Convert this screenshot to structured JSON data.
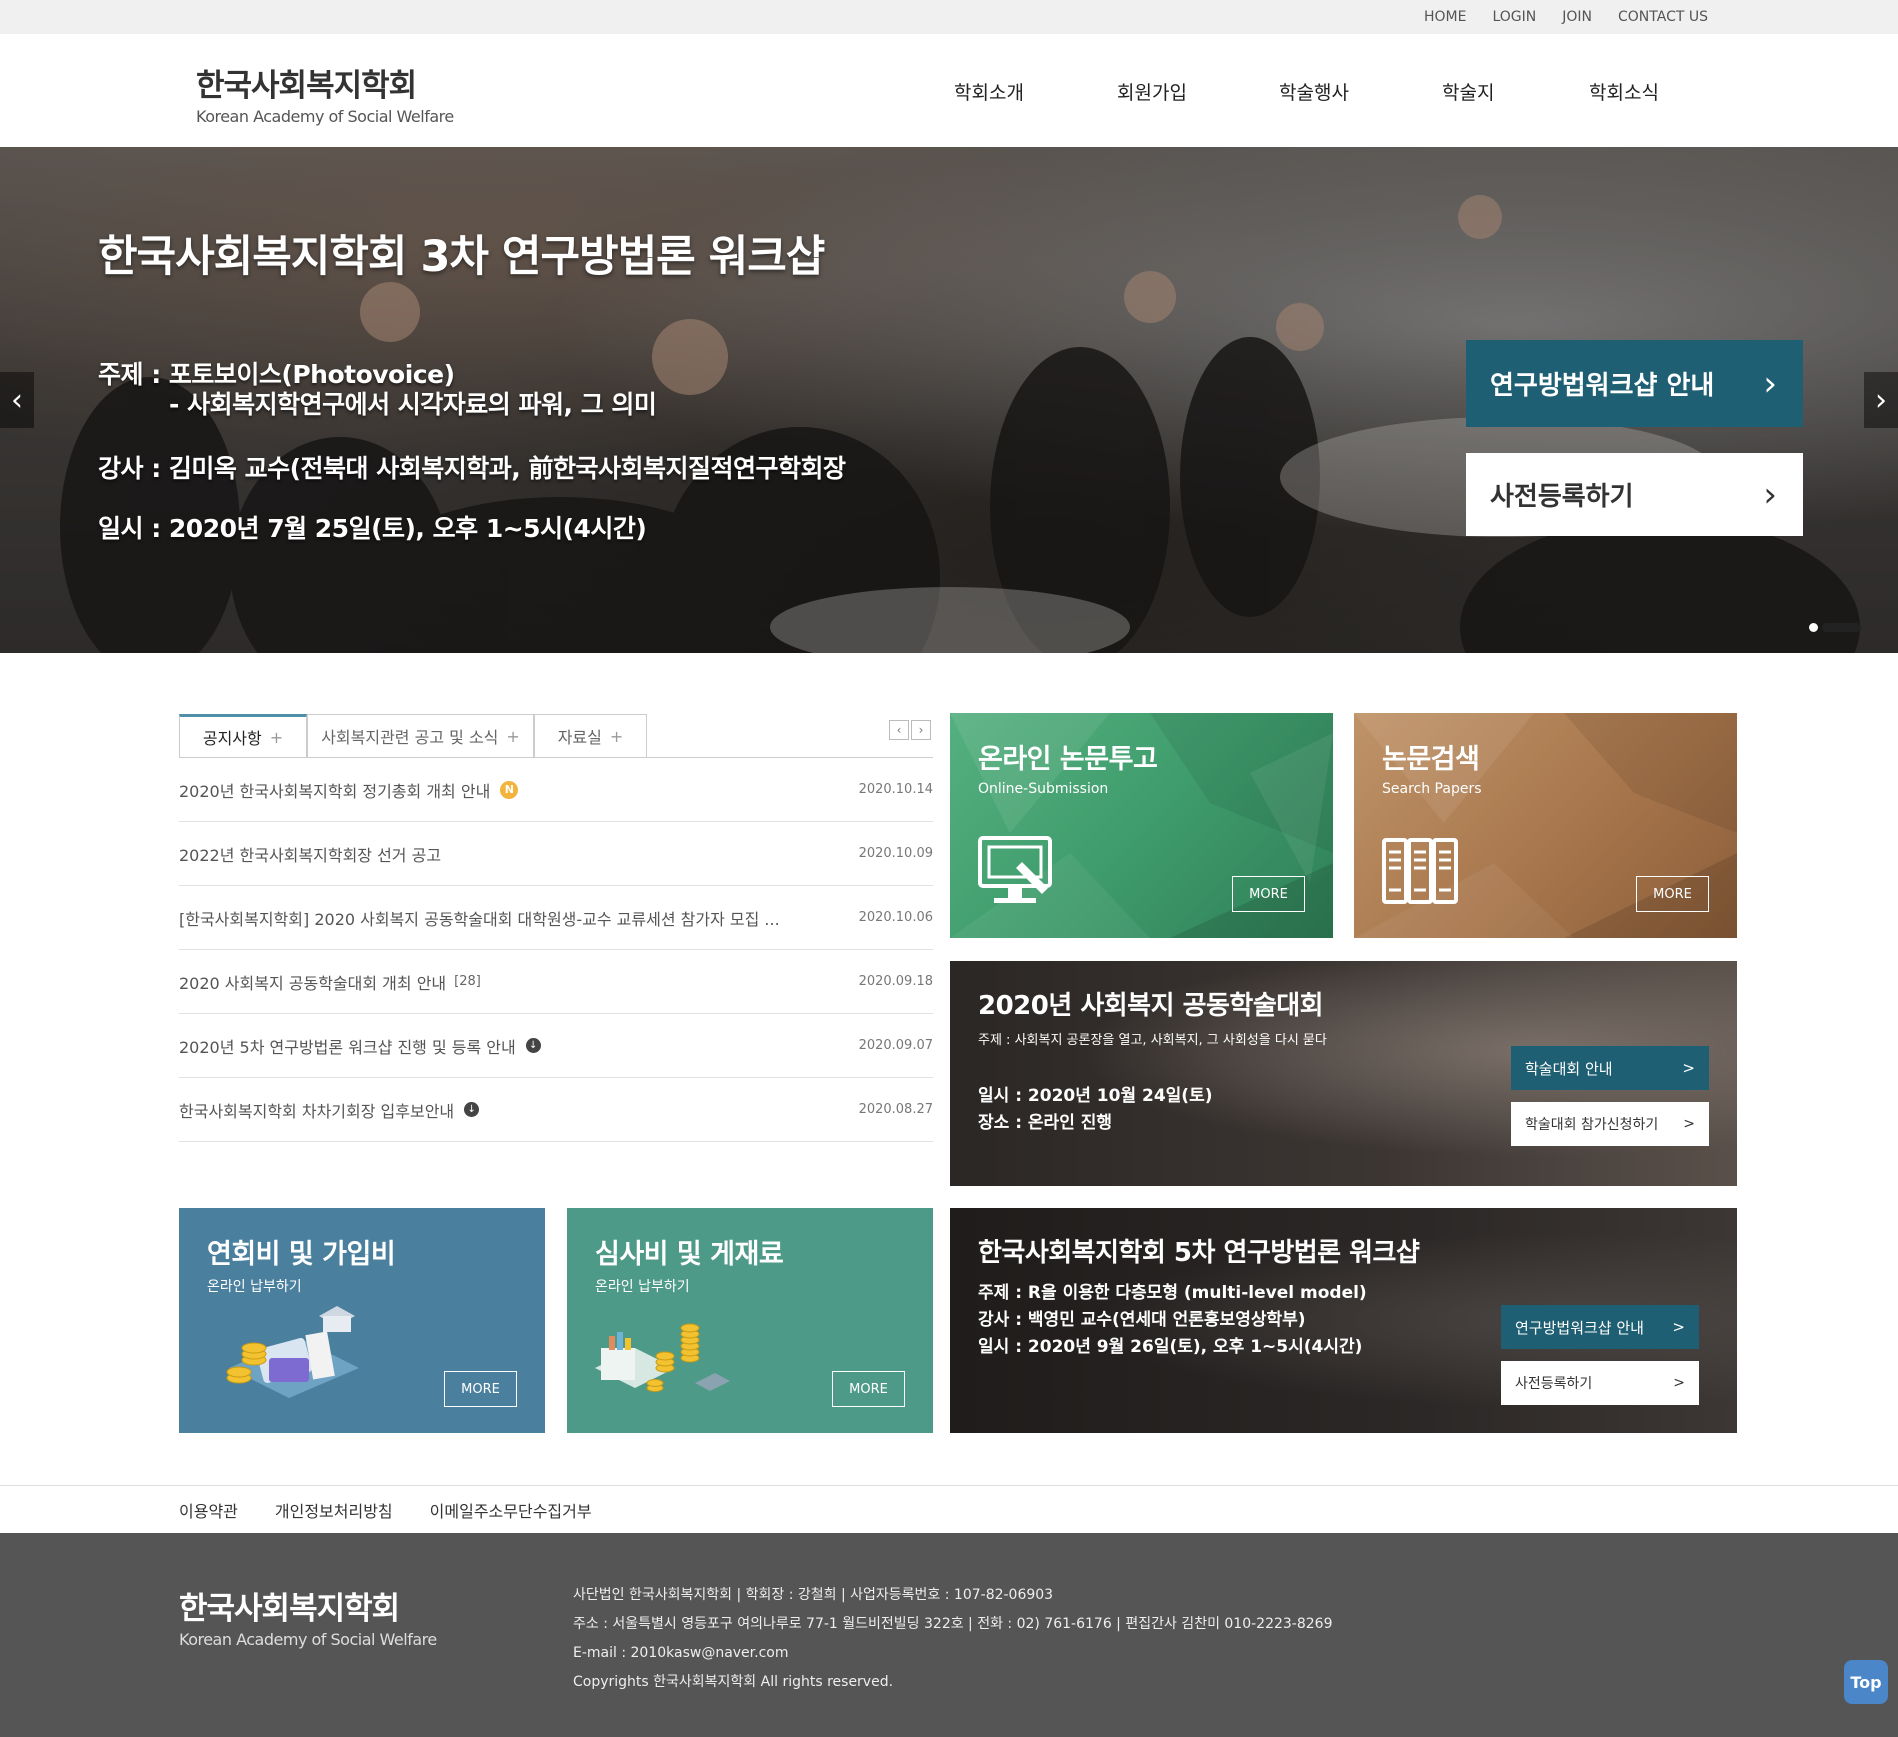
{
  "util_links": [
    "HOME",
    "LOGIN",
    "JOIN",
    "CONTACT US"
  ],
  "logo": {
    "ko": "한국사회복지학회",
    "en": "Korean Academy of Social Welfare"
  },
  "gnb": [
    "학회소개",
    "회원가입",
    "학술행사",
    "학술지",
    "학회소식"
  ],
  "hero": {
    "title": "한국사회복지학회 3차 연구방법론 워크샵",
    "lines": [
      "주제 : 포토보이스(Photovoice)",
      "- 사회복지학연구에서 시각자료의 파워, 그 의미",
      "강사 : 김미옥 교수(전북대 사회복지학과, 前한국사회복지질적연구학회장",
      "일시 : 2020년 7월 25일(토), 오후 1~5시(4시간)"
    ],
    "btn_primary": "연구방법워크샵 안내",
    "btn_secondary": "사전등록하기",
    "chev": "›",
    "prev": "‹",
    "next": "›"
  },
  "board": {
    "tabs": [
      "공지사항",
      "사회복지관련 공고 및 소식",
      "자료실"
    ],
    "tab_plus": "+",
    "pager_prev": "‹",
    "pager_next": "›",
    "posts": [
      {
        "title": "2020년 한국사회복지학회 정기총회 개최 안내",
        "date": "2020.10.14",
        "badge": "N"
      },
      {
        "title": "2022년 한국사회복지학회장 선거 공고",
        "date": "2020.10.09"
      },
      {
        "title": "[한국사회복지학회] 2020 사회복지 공동학술대회 대학원생-교수 교류세션 참가자 모집 ...",
        "date": "2020.10.06"
      },
      {
        "title": "2020 사회복지 공동학술대회 개최 안내",
        "date": "2020.09.18",
        "count": "[28]"
      },
      {
        "title": "2020년 5차 연구방법론 워크샵 진행 및 등록 안내",
        "date": "2020.09.07",
        "file": "↓"
      },
      {
        "title": "한국사회복지학회 차차기회장 입후보안내",
        "date": "2020.08.27",
        "file": "↓"
      }
    ]
  },
  "tiles": {
    "online": {
      "title": "온라인 논문투고",
      "sub": "Online-Submission",
      "more": "MORE"
    },
    "search": {
      "title": "논문검색",
      "sub": "Search Papers",
      "more": "MORE"
    },
    "conf": {
      "title": "2020년 사회복지 공동학술대회",
      "topic": "주제 : 사회복지 공론장을 열고, 사회복지, 그 사회성을 다시 묻다",
      "date": "일시 : 2020년 10월 24일(토)",
      "place": "장소 : 온라인 진행",
      "btn1": "학술대회 안내",
      "btn2": "학술대회 참가신청하기",
      "arrow": ">"
    },
    "work": {
      "title": "한국사회복지학회 5차 연구방법론 워크샵",
      "topic": "주제 : R을 이용한 다층모형 (multi-level model)",
      "lecturer": "강사 : 백영민 교수(연세대 언론홍보영상학부)",
      "date": "일시 : 2020년 9월 26일(토), 오후 1~5시(4시간)",
      "btn1": "연구방법워크샵 안내",
      "btn2": "사전등록하기",
      "arrow": ">"
    },
    "fee": {
      "title": "연회비 및 가입비",
      "sub": "온라인 납부하기",
      "more": "MORE"
    },
    "review": {
      "title": "심사비 및 게재료",
      "sub": "온라인 납부하기",
      "more": "MORE"
    }
  },
  "footer_links": [
    "이용약관",
    "개인정보처리방침",
    "이메일주소무단수집거부"
  ],
  "footer": {
    "lines": [
      "사단법인 한국사회복지학회  |  학회장 : 강철희  |  사업자등록번호 : 107-82-06903",
      "주소 : 서울특별시 영등포구 여의나루로 77-1 월드비전빌딩 322호  |  전화 : 02) 761-6176  |  편집간사 김찬미 010-2223-8269",
      "E-mail : 2010kasw@naver.com",
      "Copyrights 한국사회복지학회 All rights reserved."
    ],
    "top_btn": "Top"
  },
  "colors": {
    "accent": "#1f5f73",
    "online": "#3f9c6c",
    "search": "#a8764c",
    "fee": "#4a7f9e",
    "review": "#4e9a88",
    "footer": "#555555"
  },
  "icons": [
    "monitor-pen-icon",
    "bookshelf-icon",
    "coins-card-illustration",
    "coins-boxes-illustration"
  ]
}
